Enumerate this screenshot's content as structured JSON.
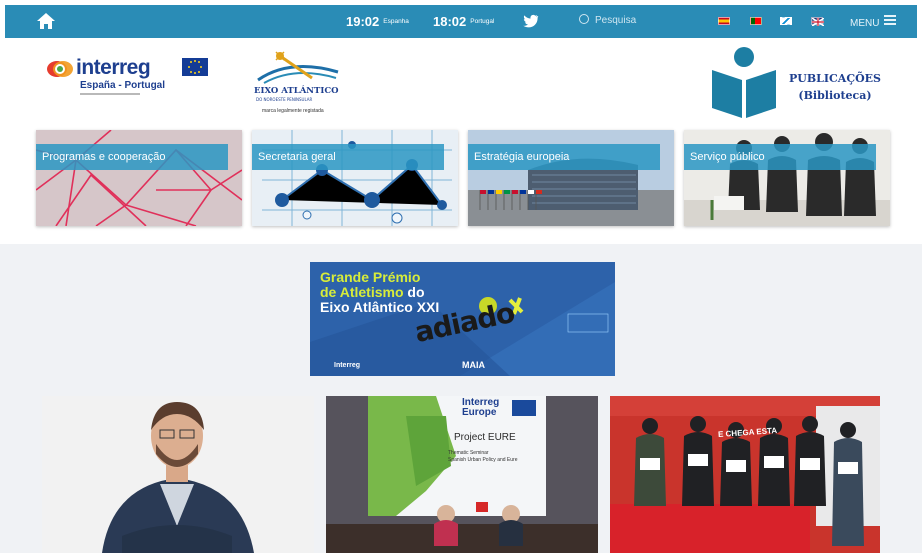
{
  "topbar": {
    "clocks": [
      {
        "time": "19:02",
        "city": "Espanha"
      },
      {
        "time": "18:02",
        "city": "Portugal"
      }
    ],
    "search_placeholder": "Pesquisa",
    "menu_label": "MENU",
    "languages": [
      "es",
      "pt",
      "gl",
      "en"
    ]
  },
  "logos": {
    "interreg_word": "interreg",
    "interreg_sub": "España - Portugal",
    "eixo_name": "EIXO ATLÁNTICO",
    "eixo_sub": "DO NOROESTE PENINSULAR",
    "eixo_registered": "marca legalmente registada",
    "publications_title": "PUBLICAÇÕES",
    "publications_sub": "(Biblioteca)"
  },
  "tiles": [
    {
      "label": "Programas e cooperação"
    },
    {
      "label": "Secretaria geral"
    },
    {
      "label": "Estratégia europeia"
    },
    {
      "label": "Serviço público"
    }
  ],
  "banner": {
    "line1": "Grande Prémio",
    "line2a": "de Atletismo",
    "line2b": " do",
    "line3": "Eixo Atlântico XXI",
    "stamp": "adiado",
    "foot_left": "Interreg",
    "foot_mid": "MAIA"
  },
  "photos": {
    "conf_brand": "Interreg",
    "conf_brand2": "Europe",
    "conf_title": "Project EURE",
    "conf_sub": "Thematic Seminar",
    "conf_sub2": "Spanish Urban Policy and Eure",
    "banner_text": "E CHEGA ESTA"
  },
  "colors": {
    "topbar": "#2a8cb6",
    "tile_label": "#2a96c3",
    "brand_blue": "#1e3f8f"
  }
}
